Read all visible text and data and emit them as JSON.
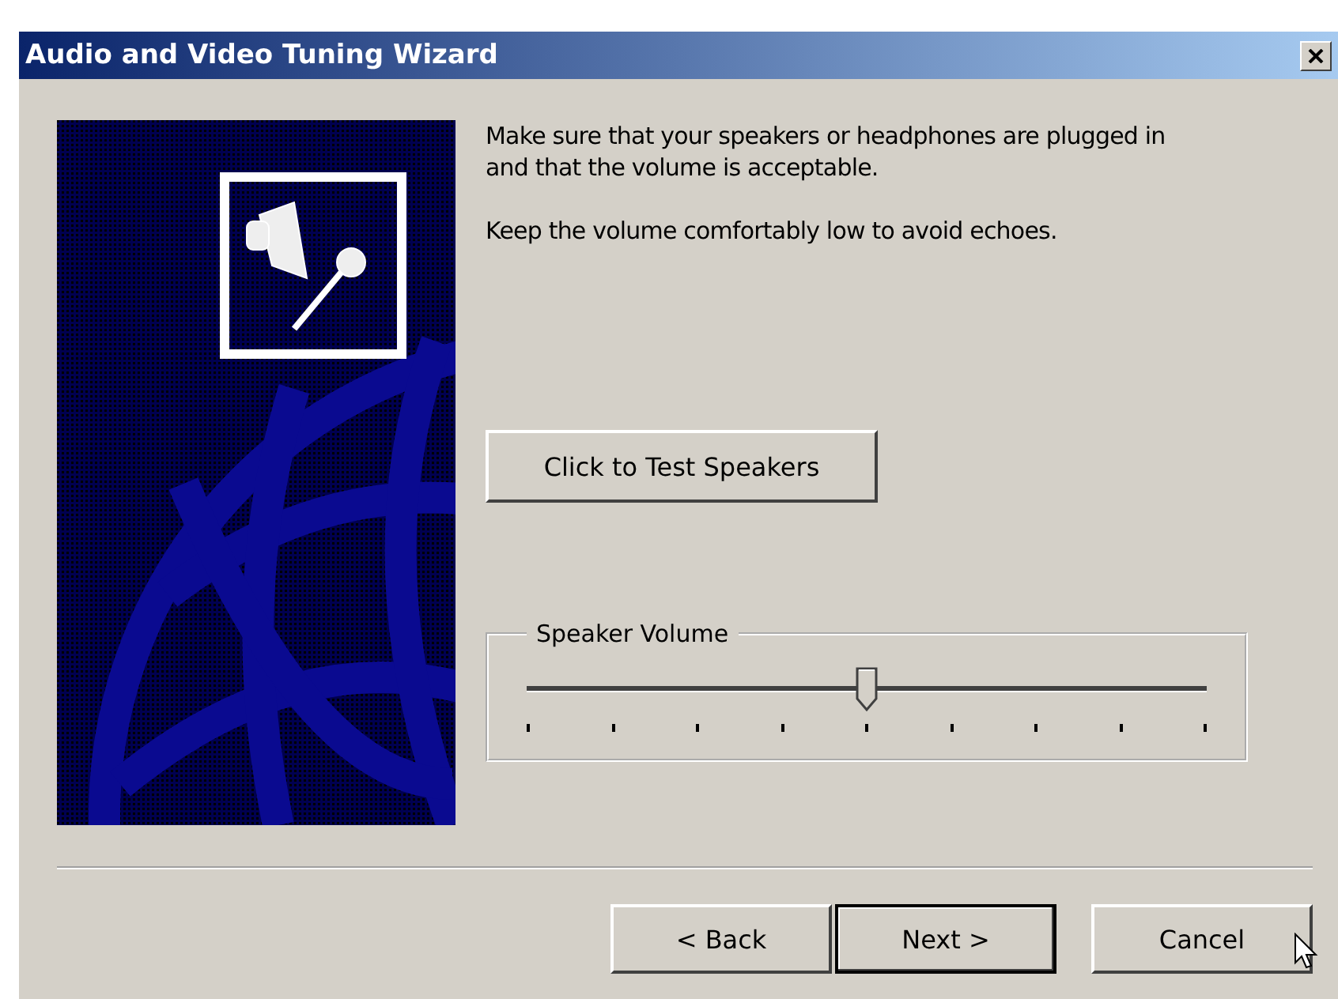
{
  "window": {
    "title": "Audio and Video Tuning Wizard"
  },
  "instructions": [
    "Make sure that your speakers or headphones are plugged in and that the volume is acceptable.",
    "Keep the volume comfortably low to avoid echoes."
  ],
  "test_button": {
    "label": "Click to Test Speakers"
  },
  "volume": {
    "label": "Speaker Volume",
    "level": 0.5
  },
  "buttons": [
    {
      "label": "< Back",
      "default": false
    },
    {
      "label": "Next >",
      "default": true
    },
    {
      "label": "Cancel",
      "default": false
    }
  ]
}
